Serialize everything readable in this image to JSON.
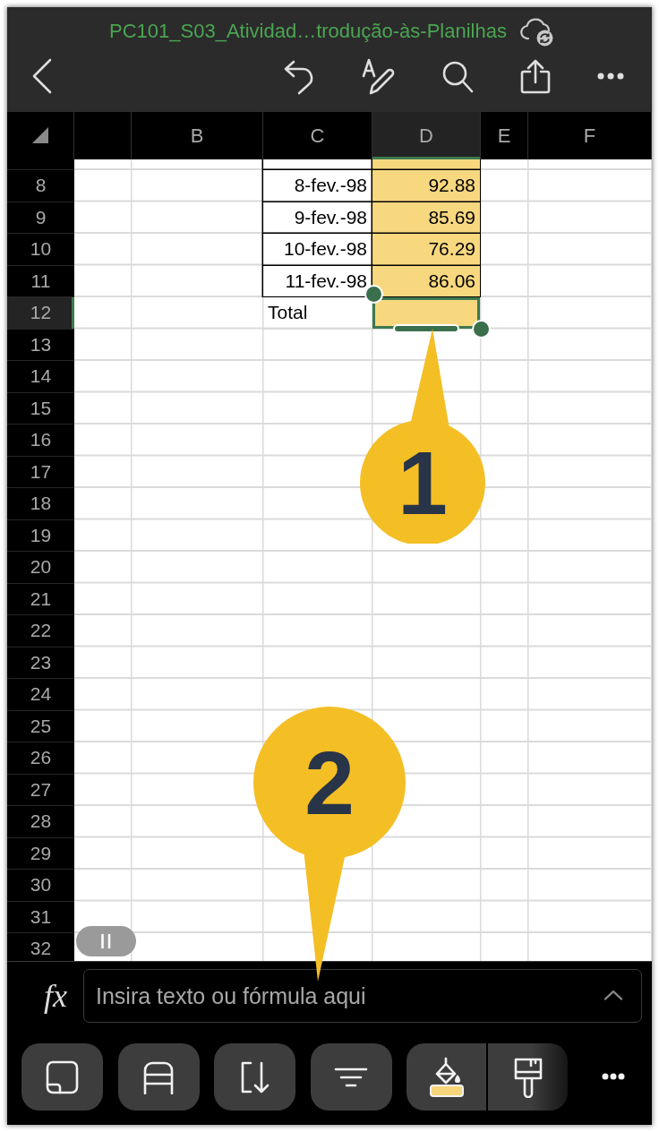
{
  "window": {
    "title": "PC101_S03_Atividad…trodução-às-Planilhas"
  },
  "sheet": {
    "columns": [
      {
        "selected": false
      },
      {
        "label": "B",
        "selected": false
      },
      {
        "label": "C",
        "selected": false
      },
      {
        "label": "D",
        "selected": true
      },
      {
        "label": "E",
        "selected": false
      },
      {
        "label": "F",
        "selected": false
      }
    ],
    "rows": [
      {
        "selected": false,
        "cells": [
          null,
          null,
          {
            "bordered": true,
            "filled": false,
            "selected": false
          },
          {
            "bordered": true,
            "filled": true,
            "selected": false
          }
        ]
      },
      {
        "number": "8",
        "selected": false,
        "cells": [
          null,
          null,
          {
            "kind": "number",
            "text": "8-fev.-98",
            "bordered": true,
            "filled": false,
            "selected": false
          },
          {
            "kind": "number",
            "text": "92.88",
            "bordered": true,
            "filled": true,
            "selected": false
          }
        ]
      },
      {
        "number": "9",
        "selected": false,
        "cells": [
          null,
          null,
          {
            "kind": "number",
            "text": "9-fev.-98",
            "bordered": true,
            "filled": false,
            "selected": false
          },
          {
            "kind": "number",
            "text": "85.69",
            "bordered": true,
            "filled": true,
            "selected": false
          }
        ]
      },
      {
        "number": "10",
        "selected": false,
        "cells": [
          null,
          null,
          {
            "kind": "number",
            "text": "10-fev.-98",
            "bordered": true,
            "filled": false,
            "selected": false
          },
          {
            "kind": "number",
            "text": "76.29",
            "bordered": true,
            "filled": true,
            "selected": false
          }
        ]
      },
      {
        "number": "11",
        "selected": false,
        "cells": [
          null,
          null,
          {
            "kind": "number",
            "text": "11-fev.-98",
            "bordered": true,
            "filled": false,
            "selected": false
          },
          {
            "kind": "number",
            "text": "86.06",
            "bordered": true,
            "filled": true,
            "selected": false
          }
        ]
      },
      {
        "number": "12",
        "selected": true,
        "cells": [
          null,
          null,
          {
            "kind": "text",
            "text": "Total",
            "bordered": false,
            "filled": false,
            "selected": false
          },
          {
            "bordered": false,
            "filled": true,
            "selected": true
          }
        ]
      },
      {
        "number": "13",
        "selected": false
      },
      {
        "number": "14",
        "selected": false
      },
      {
        "number": "15",
        "selected": false
      },
      {
        "number": "16",
        "selected": false
      },
      {
        "number": "17",
        "selected": false
      },
      {
        "number": "18",
        "selected": false
      },
      {
        "number": "19",
        "selected": false
      },
      {
        "number": "20",
        "selected": false
      },
      {
        "number": "21",
        "selected": false
      },
      {
        "number": "22",
        "selected": false
      },
      {
        "number": "23",
        "selected": false
      },
      {
        "number": "24",
        "selected": false
      },
      {
        "number": "25",
        "selected": false
      },
      {
        "number": "26",
        "selected": false
      },
      {
        "number": "27",
        "selected": false
      },
      {
        "number": "28",
        "selected": false
      },
      {
        "number": "29",
        "selected": false
      },
      {
        "number": "30",
        "selected": false
      },
      {
        "number": "31",
        "selected": false
      },
      {
        "number": "32",
        "selected": false
      }
    ]
  },
  "callouts": [
    {
      "label": "1"
    },
    {
      "label": "2"
    }
  ],
  "formula_bar": {
    "function_label": "fx",
    "placeholder": "Insira texto ou fórmula aqui"
  }
}
